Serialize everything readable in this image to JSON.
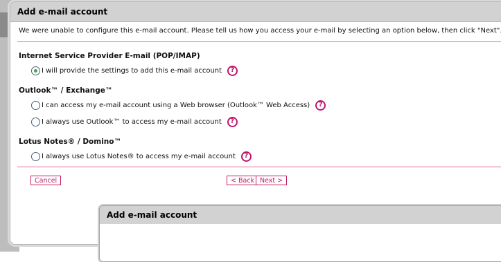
{
  "dialog": {
    "title": "Add e-mail account",
    "intro": "We were unable to configure this e-mail account. Please tell us how you access your e-mail by selecting an option below, then click \"Next\".",
    "sections": [
      {
        "title": "Internet Service Provider E-mail (POP/IMAP)",
        "options": [
          {
            "label": "I will provide the settings to add this e-mail account",
            "selected": true
          }
        ]
      },
      {
        "title": "Outlook™ / Exchange™",
        "options": [
          {
            "label": "I can access my e-mail account using a Web browser (Outlook™ Web Access)",
            "selected": false
          },
          {
            "label": "I always use Outlook™ to access my e-mail account",
            "selected": false
          }
        ]
      },
      {
        "title": "Lotus Notes® / Domino™",
        "options": [
          {
            "label": "I always use Lotus Notes® to access my e-mail account",
            "selected": false
          }
        ]
      }
    ],
    "help_glyph": "?",
    "buttons": {
      "cancel": "Cancel",
      "back": "< Back",
      "next": "Next >"
    }
  },
  "dialog2": {
    "title": "Add e-mail account"
  },
  "colors": {
    "accent": "#c21a5f",
    "rule": "#e06a98",
    "radio_selected": "#4ba34b",
    "titlebar": "#d2d2d2"
  }
}
